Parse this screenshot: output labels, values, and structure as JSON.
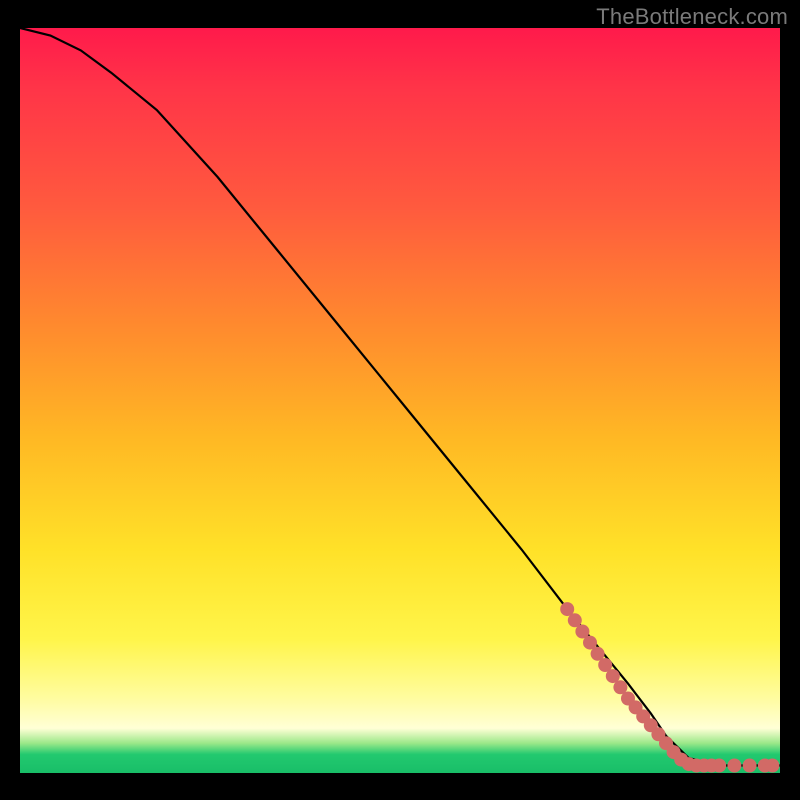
{
  "watermark": "TheBottleneck.com",
  "chart_data": {
    "type": "line",
    "title": "",
    "xlabel": "",
    "ylabel": "",
    "xlim": [
      0,
      100
    ],
    "ylim": [
      0,
      100
    ],
    "series": [
      {
        "name": "curve",
        "x": [
          0,
          4,
          8,
          12,
          18,
          26,
          34,
          42,
          50,
          58,
          66,
          72,
          76,
          80,
          83,
          85,
          88,
          92,
          95,
          100
        ],
        "y": [
          100,
          99,
          97,
          94,
          89,
          80,
          70,
          60,
          50,
          40,
          30,
          22,
          17,
          12,
          8,
          5,
          2,
          1,
          1,
          1
        ]
      }
    ],
    "markers": {
      "name": "dots",
      "color": "#d26a66",
      "points": [
        {
          "x": 72,
          "y": 22
        },
        {
          "x": 73,
          "y": 20.5
        },
        {
          "x": 74,
          "y": 19
        },
        {
          "x": 75,
          "y": 17.5
        },
        {
          "x": 76,
          "y": 16
        },
        {
          "x": 77,
          "y": 14.5
        },
        {
          "x": 78,
          "y": 13
        },
        {
          "x": 79,
          "y": 11.5
        },
        {
          "x": 80,
          "y": 10
        },
        {
          "x": 81,
          "y": 8.8
        },
        {
          "x": 82,
          "y": 7.6
        },
        {
          "x": 83,
          "y": 6.4
        },
        {
          "x": 84,
          "y": 5.2
        },
        {
          "x": 85,
          "y": 4.0
        },
        {
          "x": 86,
          "y": 2.8
        },
        {
          "x": 87,
          "y": 1.8
        },
        {
          "x": 88,
          "y": 1.2
        },
        {
          "x": 89,
          "y": 1.0
        },
        {
          "x": 90,
          "y": 1.0
        },
        {
          "x": 91,
          "y": 1.0
        },
        {
          "x": 92,
          "y": 1.0
        },
        {
          "x": 94,
          "y": 1.0
        },
        {
          "x": 96,
          "y": 1.0
        },
        {
          "x": 98,
          "y": 1.0
        },
        {
          "x": 99,
          "y": 1.0
        }
      ]
    },
    "gradient_stops": [
      {
        "pos": 0.0,
        "color": "#ff1a4b"
      },
      {
        "pos": 0.55,
        "color": "#ffb824"
      },
      {
        "pos": 0.82,
        "color": "#fff54a"
      },
      {
        "pos": 0.97,
        "color": "#22c96f"
      },
      {
        "pos": 1.0,
        "color": "#19be68"
      }
    ]
  }
}
